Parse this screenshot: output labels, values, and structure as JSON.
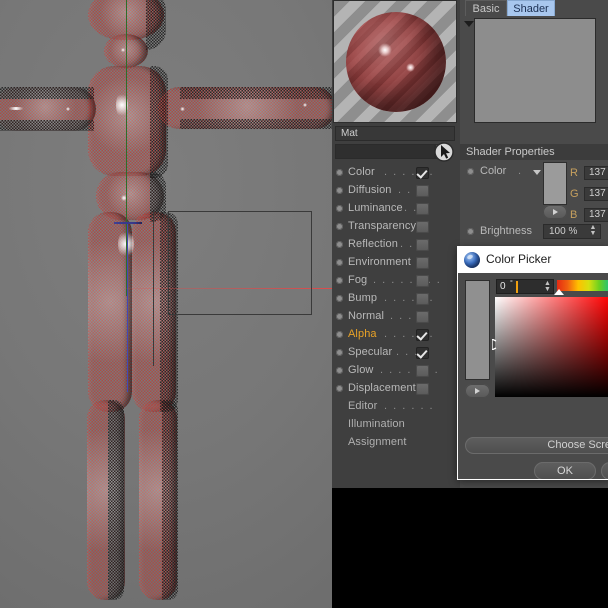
{
  "viewport": {
    "name": "3d-viewport",
    "model": "humanoid-character-t-pose",
    "axes": {
      "y_color": "#2f6d2a",
      "x_color": "#e04a4a",
      "z_color": "#4646b4"
    },
    "selection_rect": true
  },
  "material_editor": {
    "preview_name": "material-preview-sphere",
    "material_name": "Mat",
    "search_value": "",
    "channels": [
      {
        "label": "Color",
        "dots": ". . . . . .",
        "checked": true,
        "highlight": false
      },
      {
        "label": "Diffusion",
        "dots": ". . . .",
        "checked": false,
        "highlight": false
      },
      {
        "label": "Luminance",
        "dots": ". .",
        "checked": false,
        "highlight": false
      },
      {
        "label": "Transparency",
        "dots": "",
        "checked": false,
        "highlight": false
      },
      {
        "label": "Reflection",
        "dots": ". . .",
        "checked": false,
        "highlight": false
      },
      {
        "label": "Environment",
        "dots": "",
        "checked": false,
        "highlight": false
      },
      {
        "label": "Fog",
        "dots": ". . . . . . . .",
        "checked": false,
        "highlight": false
      },
      {
        "label": "Bump",
        "dots": ". . . . . .",
        "checked": false,
        "highlight": false
      },
      {
        "label": "Normal",
        "dots": ". . . . .",
        "checked": false,
        "highlight": false
      },
      {
        "label": "Alpha",
        "dots": ". . . . . .",
        "checked": true,
        "highlight": true
      },
      {
        "label": "Specular",
        "dots": ". . . .",
        "checked": true,
        "highlight": false
      },
      {
        "label": "Glow",
        "dots": ". . . . . . .",
        "checked": false,
        "highlight": false
      },
      {
        "label": "Displacement",
        "dots": "",
        "checked": false,
        "highlight": false
      }
    ],
    "plain_items": [
      {
        "label": "Editor",
        "dots": ". . . . . ."
      },
      {
        "label": "Illumination",
        "dots": ""
      },
      {
        "label": "Assignment",
        "dots": ""
      }
    ],
    "tabs": [
      {
        "label": "Basic",
        "active": false
      },
      {
        "label": "Shader",
        "active": true
      }
    ],
    "shader_properties": {
      "header": "Shader Properties",
      "color_label": "Color",
      "color_dots": ".",
      "swatch_hex": "#9b9b9b",
      "rgb": [
        {
          "label": "R",
          "value": "137"
        },
        {
          "label": "G",
          "value": "137"
        },
        {
          "label": "B",
          "value": "137"
        }
      ],
      "brightness_label": "Brightness",
      "brightness_value": "100 %"
    }
  },
  "color_picker": {
    "title": "Color Picker",
    "icon": "c4d-sphere-icon",
    "hue_value": "0",
    "hue_unit": "°",
    "preview_hex": "#909090",
    "choose_screen_label": "Choose Scre",
    "ok_label": "OK"
  }
}
